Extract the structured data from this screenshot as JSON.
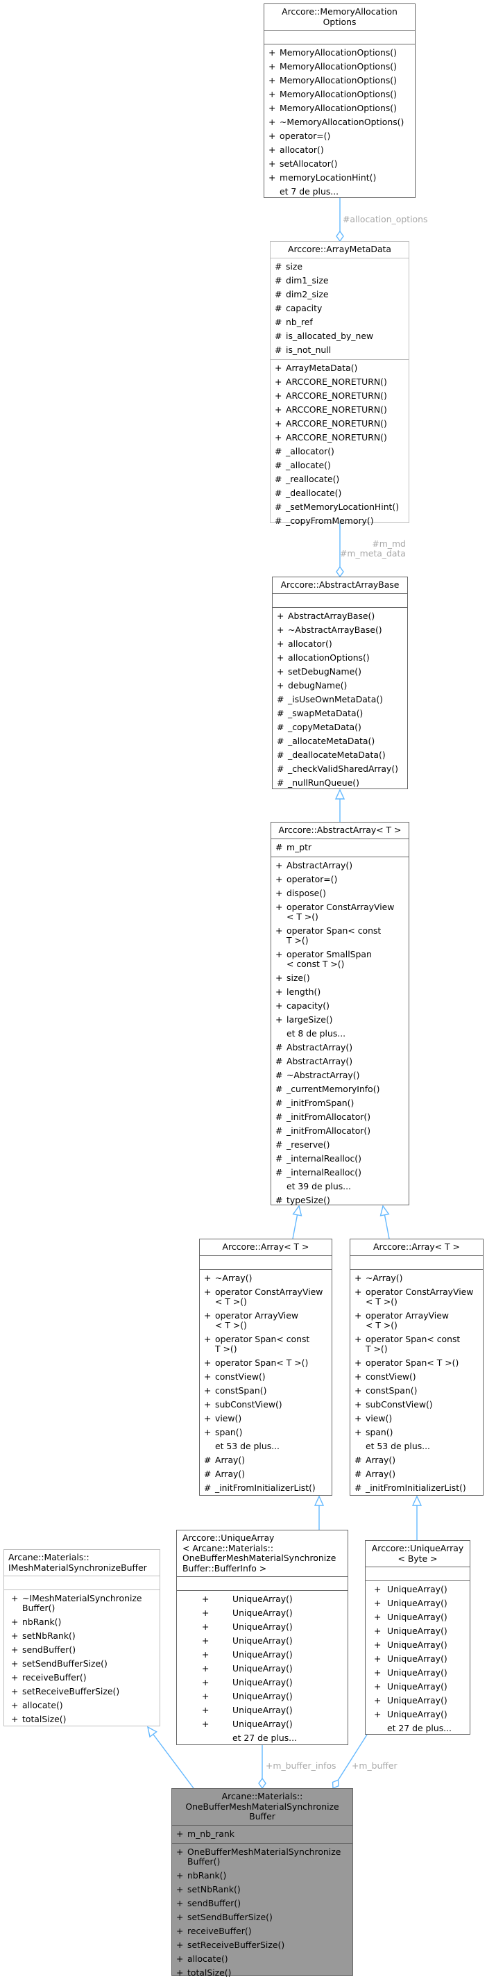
{
  "colors": {
    "edge": "#63b8ff",
    "edge_label": "#a8a8a8",
    "main_fill": "#999999",
    "border_dark": "#666666",
    "border_light": "#bfbfbf"
  },
  "nodes": {
    "memory_allocation_options": {
      "title": "Arccore::MemoryAllocation\nOptions",
      "attributes": [],
      "methods": [
        {
          "v": "+",
          "t": "MemoryAllocationOptions()"
        },
        {
          "v": "+",
          "t": "MemoryAllocationOptions()"
        },
        {
          "v": "+",
          "t": "MemoryAllocationOptions()"
        },
        {
          "v": "+",
          "t": "MemoryAllocationOptions()"
        },
        {
          "v": "+",
          "t": "MemoryAllocationOptions()"
        },
        {
          "v": "+",
          "t": "~MemoryAllocationOptions()"
        },
        {
          "v": "+",
          "t": "operator=()"
        },
        {
          "v": "+",
          "t": "allocator()"
        },
        {
          "v": "+",
          "t": "setAllocator()"
        },
        {
          "v": "+",
          "t": "memoryLocationHint()"
        },
        {
          "v": "",
          "t": "et 7 de plus..."
        }
      ]
    },
    "array_meta_data": {
      "title": "Arccore::ArrayMetaData",
      "attributes": [
        {
          "v": "#",
          "t": "size"
        },
        {
          "v": "#",
          "t": "dim1_size"
        },
        {
          "v": "#",
          "t": "dim2_size"
        },
        {
          "v": "#",
          "t": "capacity"
        },
        {
          "v": "#",
          "t": "nb_ref"
        },
        {
          "v": "#",
          "t": "is_allocated_by_new"
        },
        {
          "v": "#",
          "t": "is_not_null"
        }
      ],
      "methods": [
        {
          "v": "+",
          "t": "ArrayMetaData()"
        },
        {
          "v": "+",
          "t": "ARCCORE_NORETURN()"
        },
        {
          "v": "+",
          "t": "ARCCORE_NORETURN()"
        },
        {
          "v": "+",
          "t": "ARCCORE_NORETURN()"
        },
        {
          "v": "+",
          "t": "ARCCORE_NORETURN()"
        },
        {
          "v": "+",
          "t": "ARCCORE_NORETURN()"
        },
        {
          "v": "#",
          "t": "_allocator()"
        },
        {
          "v": "#",
          "t": "_allocate()"
        },
        {
          "v": "#",
          "t": "_reallocate()"
        },
        {
          "v": "#",
          "t": "_deallocate()"
        },
        {
          "v": "#",
          "t": "_setMemoryLocationHint()"
        },
        {
          "v": "#",
          "t": "_copyFromMemory()"
        }
      ]
    },
    "abstract_array_base": {
      "title": "Arccore::AbstractArrayBase",
      "attributes": [],
      "methods": [
        {
          "v": "+",
          "t": "AbstractArrayBase()"
        },
        {
          "v": "+",
          "t": "~AbstractArrayBase()"
        },
        {
          "v": "+",
          "t": "allocator()"
        },
        {
          "v": "+",
          "t": "allocationOptions()"
        },
        {
          "v": "+",
          "t": "setDebugName()"
        },
        {
          "v": "+",
          "t": "debugName()"
        },
        {
          "v": "#",
          "t": "_isUseOwnMetaData()"
        },
        {
          "v": "#",
          "t": "_swapMetaData()"
        },
        {
          "v": "#",
          "t": "_copyMetaData()"
        },
        {
          "v": "#",
          "t": "_allocateMetaData()"
        },
        {
          "v": "#",
          "t": "_deallocateMetaData()"
        },
        {
          "v": "#",
          "t": "_checkValidSharedArray()"
        },
        {
          "v": "#",
          "t": "_nullRunQueue()"
        }
      ]
    },
    "abstract_array": {
      "title": "Arccore::AbstractArray< T >",
      "attributes": [
        {
          "v": "#",
          "t": "m_ptr"
        }
      ],
      "methods": [
        {
          "v": "+",
          "t": "AbstractArray()"
        },
        {
          "v": "+",
          "t": "operator=()"
        },
        {
          "v": "+",
          "t": "dispose()"
        },
        {
          "v": "+",
          "t": "operator ConstArrayView\n< T >()"
        },
        {
          "v": "+",
          "t": "operator Span< const\n T >()"
        },
        {
          "v": "+",
          "t": "operator SmallSpan\n< const T >()"
        },
        {
          "v": "+",
          "t": "size()"
        },
        {
          "v": "+",
          "t": "length()"
        },
        {
          "v": "+",
          "t": "capacity()"
        },
        {
          "v": "+",
          "t": "largeSize()"
        },
        {
          "v": "",
          "t": "et 8 de plus..."
        },
        {
          "v": "#",
          "t": "AbstractArray()"
        },
        {
          "v": "#",
          "t": "AbstractArray()"
        },
        {
          "v": "#",
          "t": "~AbstractArray()"
        },
        {
          "v": "#",
          "t": "_currentMemoryInfo()"
        },
        {
          "v": "#",
          "t": "_initFromSpan()"
        },
        {
          "v": "#",
          "t": "_initFromAllocator()"
        },
        {
          "v": "#",
          "t": "_initFromAllocator()"
        },
        {
          "v": "#",
          "t": "_reserve()"
        },
        {
          "v": "#",
          "t": "_internalRealloc()"
        },
        {
          "v": "#",
          "t": "_internalRealloc()"
        },
        {
          "v": "",
          "t": "et 39 de plus..."
        },
        {
          "v": "#",
          "t": "typeSize()"
        }
      ]
    },
    "array_left": {
      "title": "Arccore::Array< T >",
      "attributes": [],
      "methods": [
        {
          "v": "+",
          "t": "~Array()"
        },
        {
          "v": "+",
          "t": "operator ConstArrayView\n< T >()"
        },
        {
          "v": "+",
          "t": "operator ArrayView\n< T >()"
        },
        {
          "v": "+",
          "t": "operator Span< const\n T >()"
        },
        {
          "v": "+",
          "t": "operator Span< T >()"
        },
        {
          "v": "+",
          "t": "constView()"
        },
        {
          "v": "+",
          "t": "constSpan()"
        },
        {
          "v": "+",
          "t": "subConstView()"
        },
        {
          "v": "+",
          "t": "view()"
        },
        {
          "v": "+",
          "t": "span()"
        },
        {
          "v": "",
          "t": "et 53 de plus..."
        },
        {
          "v": "#",
          "t": "Array()"
        },
        {
          "v": "#",
          "t": "Array()"
        },
        {
          "v": "#",
          "t": "_initFromInitializerList()"
        }
      ]
    },
    "array_right": {
      "title": "Arccore::Array< T >",
      "attributes": [],
      "methods": [
        {
          "v": "+",
          "t": "~Array()"
        },
        {
          "v": "+",
          "t": "operator ConstArrayView\n< T >()"
        },
        {
          "v": "+",
          "t": "operator ArrayView\n< T >()"
        },
        {
          "v": "+",
          "t": "operator Span< const\n T >()"
        },
        {
          "v": "+",
          "t": "operator Span< T >()"
        },
        {
          "v": "+",
          "t": "constView()"
        },
        {
          "v": "+",
          "t": "constSpan()"
        },
        {
          "v": "+",
          "t": "subConstView()"
        },
        {
          "v": "+",
          "t": "view()"
        },
        {
          "v": "+",
          "t": "span()"
        },
        {
          "v": "",
          "t": "et 53 de plus..."
        },
        {
          "v": "#",
          "t": "Array()"
        },
        {
          "v": "#",
          "t": "Array()"
        },
        {
          "v": "#",
          "t": "_initFromInitializerList()"
        }
      ]
    },
    "imesh_buffer": {
      "title": "Arcane::Materials::\nIMeshMaterialSynchronizeBuffer",
      "attributes": [],
      "methods": [
        {
          "v": "+",
          "t": "~IMeshMaterialSynchronize\nBuffer()"
        },
        {
          "v": "+",
          "t": "nbRank()"
        },
        {
          "v": "+",
          "t": "setNbRank()"
        },
        {
          "v": "+",
          "t": "sendBuffer()"
        },
        {
          "v": "+",
          "t": "setSendBufferSize()"
        },
        {
          "v": "+",
          "t": "receiveBuffer()"
        },
        {
          "v": "+",
          "t": "setReceiveBufferSize()"
        },
        {
          "v": "+",
          "t": "allocate()"
        },
        {
          "v": "+",
          "t": "totalSize()"
        }
      ]
    },
    "unique_array_bufferinfo": {
      "title": "Arccore::UniqueArray\n< Arcane::Materials::\nOneBufferMeshMaterialSynchronize\nBuffer::BufferInfo >",
      "attributes": [],
      "methods": [
        {
          "v": "+",
          "t": "UniqueArray()"
        },
        {
          "v": "+",
          "t": "UniqueArray()"
        },
        {
          "v": "+",
          "t": "UniqueArray()"
        },
        {
          "v": "+",
          "t": "UniqueArray()"
        },
        {
          "v": "+",
          "t": "UniqueArray()"
        },
        {
          "v": "+",
          "t": "UniqueArray()"
        },
        {
          "v": "+",
          "t": "UniqueArray()"
        },
        {
          "v": "+",
          "t": "UniqueArray()"
        },
        {
          "v": "+",
          "t": "UniqueArray()"
        },
        {
          "v": "+",
          "t": "UniqueArray()"
        },
        {
          "v": "",
          "t": "et 27 de plus..."
        }
      ]
    },
    "unique_array_byte": {
      "title": "Arccore::UniqueArray\n< Byte >",
      "attributes": [],
      "methods": [
        {
          "v": "+",
          "t": "UniqueArray()"
        },
        {
          "v": "+",
          "t": "UniqueArray()"
        },
        {
          "v": "+",
          "t": "UniqueArray()"
        },
        {
          "v": "+",
          "t": "UniqueArray()"
        },
        {
          "v": "+",
          "t": "UniqueArray()"
        },
        {
          "v": "+",
          "t": "UniqueArray()"
        },
        {
          "v": "+",
          "t": "UniqueArray()"
        },
        {
          "v": "+",
          "t": "UniqueArray()"
        },
        {
          "v": "+",
          "t": "UniqueArray()"
        },
        {
          "v": "+",
          "t": "UniqueArray()"
        },
        {
          "v": "",
          "t": "et 27 de plus..."
        }
      ]
    },
    "one_buffer_main": {
      "title": "Arcane::Materials::\nOneBufferMeshMaterialSynchronize\nBuffer",
      "attributes": [
        {
          "v": "+",
          "t": "m_nb_rank"
        }
      ],
      "methods": [
        {
          "v": "+",
          "t": "OneBufferMeshMaterialSynchronize\nBuffer()"
        },
        {
          "v": "+",
          "t": "nbRank()"
        },
        {
          "v": "+",
          "t": "setNbRank()"
        },
        {
          "v": "+",
          "t": "sendBuffer()"
        },
        {
          "v": "+",
          "t": "setSendBufferSize()"
        },
        {
          "v": "+",
          "t": "receiveBuffer()"
        },
        {
          "v": "+",
          "t": "setReceiveBufferSize()"
        },
        {
          "v": "+",
          "t": "allocate()"
        },
        {
          "v": "+",
          "t": "totalSize()"
        }
      ]
    }
  },
  "edge_labels": {
    "allocation_options": "#allocation_options",
    "m_md": "#m_md\n#m_meta_data",
    "m_buffer_infos": "+m_buffer_infos",
    "m_buffer": "+m_buffer"
  }
}
